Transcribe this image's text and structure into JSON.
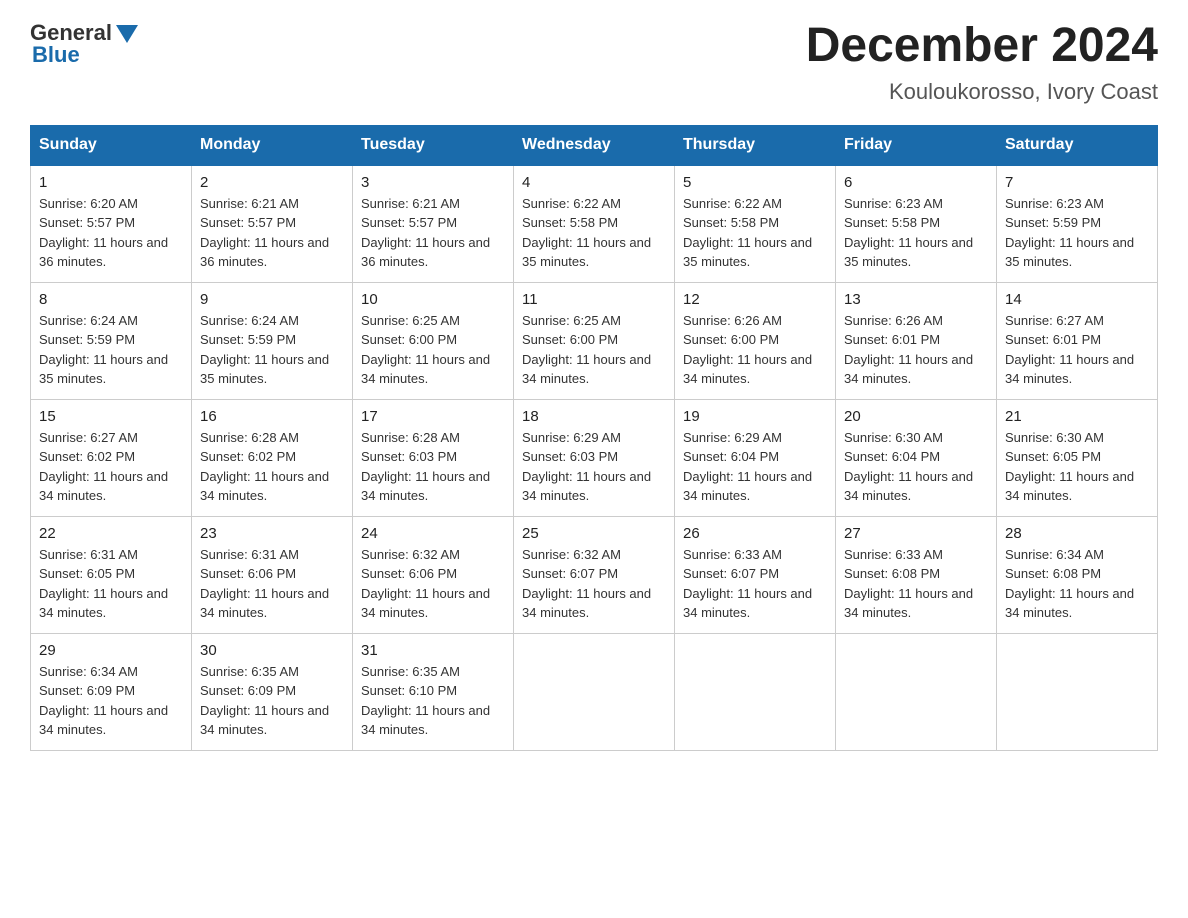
{
  "logo": {
    "text_general": "General",
    "text_blue": "Blue"
  },
  "title": "December 2024",
  "subtitle": "Kouloukorosso, Ivory Coast",
  "days_of_week": [
    "Sunday",
    "Monday",
    "Tuesday",
    "Wednesday",
    "Thursday",
    "Friday",
    "Saturday"
  ],
  "weeks": [
    [
      {
        "day": "1",
        "sunrise": "6:20 AM",
        "sunset": "5:57 PM",
        "daylight": "11 hours and 36 minutes."
      },
      {
        "day": "2",
        "sunrise": "6:21 AM",
        "sunset": "5:57 PM",
        "daylight": "11 hours and 36 minutes."
      },
      {
        "day": "3",
        "sunrise": "6:21 AM",
        "sunset": "5:57 PM",
        "daylight": "11 hours and 36 minutes."
      },
      {
        "day": "4",
        "sunrise": "6:22 AM",
        "sunset": "5:58 PM",
        "daylight": "11 hours and 35 minutes."
      },
      {
        "day": "5",
        "sunrise": "6:22 AM",
        "sunset": "5:58 PM",
        "daylight": "11 hours and 35 minutes."
      },
      {
        "day": "6",
        "sunrise": "6:23 AM",
        "sunset": "5:58 PM",
        "daylight": "11 hours and 35 minutes."
      },
      {
        "day": "7",
        "sunrise": "6:23 AM",
        "sunset": "5:59 PM",
        "daylight": "11 hours and 35 minutes."
      }
    ],
    [
      {
        "day": "8",
        "sunrise": "6:24 AM",
        "sunset": "5:59 PM",
        "daylight": "11 hours and 35 minutes."
      },
      {
        "day": "9",
        "sunrise": "6:24 AM",
        "sunset": "5:59 PM",
        "daylight": "11 hours and 35 minutes."
      },
      {
        "day": "10",
        "sunrise": "6:25 AM",
        "sunset": "6:00 PM",
        "daylight": "11 hours and 34 minutes."
      },
      {
        "day": "11",
        "sunrise": "6:25 AM",
        "sunset": "6:00 PM",
        "daylight": "11 hours and 34 minutes."
      },
      {
        "day": "12",
        "sunrise": "6:26 AM",
        "sunset": "6:00 PM",
        "daylight": "11 hours and 34 minutes."
      },
      {
        "day": "13",
        "sunrise": "6:26 AM",
        "sunset": "6:01 PM",
        "daylight": "11 hours and 34 minutes."
      },
      {
        "day": "14",
        "sunrise": "6:27 AM",
        "sunset": "6:01 PM",
        "daylight": "11 hours and 34 minutes."
      }
    ],
    [
      {
        "day": "15",
        "sunrise": "6:27 AM",
        "sunset": "6:02 PM",
        "daylight": "11 hours and 34 minutes."
      },
      {
        "day": "16",
        "sunrise": "6:28 AM",
        "sunset": "6:02 PM",
        "daylight": "11 hours and 34 minutes."
      },
      {
        "day": "17",
        "sunrise": "6:28 AM",
        "sunset": "6:03 PM",
        "daylight": "11 hours and 34 minutes."
      },
      {
        "day": "18",
        "sunrise": "6:29 AM",
        "sunset": "6:03 PM",
        "daylight": "11 hours and 34 minutes."
      },
      {
        "day": "19",
        "sunrise": "6:29 AM",
        "sunset": "6:04 PM",
        "daylight": "11 hours and 34 minutes."
      },
      {
        "day": "20",
        "sunrise": "6:30 AM",
        "sunset": "6:04 PM",
        "daylight": "11 hours and 34 minutes."
      },
      {
        "day": "21",
        "sunrise": "6:30 AM",
        "sunset": "6:05 PM",
        "daylight": "11 hours and 34 minutes."
      }
    ],
    [
      {
        "day": "22",
        "sunrise": "6:31 AM",
        "sunset": "6:05 PM",
        "daylight": "11 hours and 34 minutes."
      },
      {
        "day": "23",
        "sunrise": "6:31 AM",
        "sunset": "6:06 PM",
        "daylight": "11 hours and 34 minutes."
      },
      {
        "day": "24",
        "sunrise": "6:32 AM",
        "sunset": "6:06 PM",
        "daylight": "11 hours and 34 minutes."
      },
      {
        "day": "25",
        "sunrise": "6:32 AM",
        "sunset": "6:07 PM",
        "daylight": "11 hours and 34 minutes."
      },
      {
        "day": "26",
        "sunrise": "6:33 AM",
        "sunset": "6:07 PM",
        "daylight": "11 hours and 34 minutes."
      },
      {
        "day": "27",
        "sunrise": "6:33 AM",
        "sunset": "6:08 PM",
        "daylight": "11 hours and 34 minutes."
      },
      {
        "day": "28",
        "sunrise": "6:34 AM",
        "sunset": "6:08 PM",
        "daylight": "11 hours and 34 minutes."
      }
    ],
    [
      {
        "day": "29",
        "sunrise": "6:34 AM",
        "sunset": "6:09 PM",
        "daylight": "11 hours and 34 minutes."
      },
      {
        "day": "30",
        "sunrise": "6:35 AM",
        "sunset": "6:09 PM",
        "daylight": "11 hours and 34 minutes."
      },
      {
        "day": "31",
        "sunrise": "6:35 AM",
        "sunset": "6:10 PM",
        "daylight": "11 hours and 34 minutes."
      },
      null,
      null,
      null,
      null
    ]
  ],
  "labels": {
    "sunrise": "Sunrise:",
    "sunset": "Sunset:",
    "daylight": "Daylight:"
  }
}
